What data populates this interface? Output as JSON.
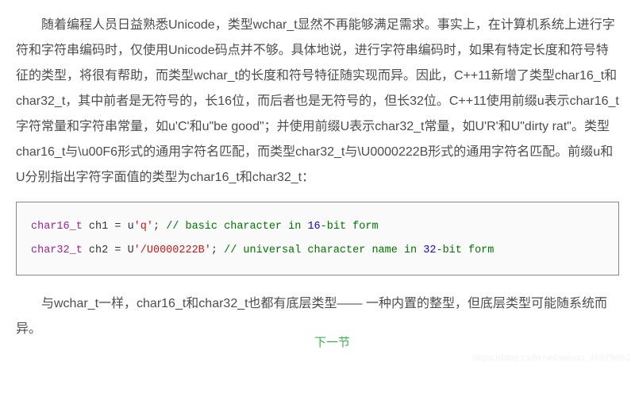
{
  "paragraphs": {
    "p1": "随着编程人员日益熟悉Unicode，类型wchar_t显然不再能够满足需求。事实上，在计算机系统上进行字符和字符串编码时，仅使用Unicode码点并不够。具体地说，进行字符串编码时，如果有特定长度和符号特征的类型，将很有帮助，而类型wchar_t的长度和符号特征随实现而异。因此，C++11新增了类型char16_t和char32_t，其中前者是无符号的，长16位，而后者也是无符号的，但长32位。C++11使用前缀u表示char16_t字符常量和字符串常量，如u'C'和u\"be good\"；并使用前缀U表示char32_t常量，如U'R'和U\"dirty rat\"。类型char16_t与\\u00F6形式的通用字符名匹配，而类型char32_t与\\U0000222B形式的通用字符名匹配。前缀u和U分别指出字符字面值的类型为char16_t和char32_t：",
    "p2": "与wchar_t一样，char16_t和char32_t也都有底层类型—— 一种内置的整型，但底层类型可能随系统而异。"
  },
  "code": {
    "line1": {
      "type": "char16_t",
      "var": "ch1",
      "op": "=",
      "prefix": "u",
      "str": "'q'",
      "semi": ";",
      "comment_prefix": "// basic character in ",
      "comment_num": "16",
      "comment_suffix": "-bit form"
    },
    "line2": {
      "type": "char32_t",
      "var": "ch2",
      "op": "=",
      "prefix": "U",
      "str": "'/U0000222B'",
      "semi": ";",
      "comment_prefix": "// universal character name in ",
      "comment_num": "32",
      "comment_suffix": "-bit form"
    }
  },
  "nav": {
    "next": "下一节"
  },
  "watermark": "https://blog.csdn.net/weixin_46075662"
}
